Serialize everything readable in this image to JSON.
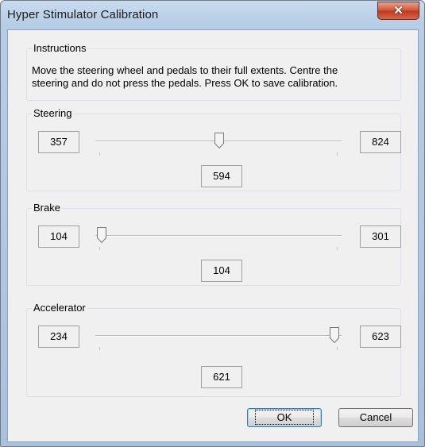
{
  "window": {
    "title": "Hyper Stimulator Calibration",
    "close_glyph": "✕"
  },
  "instructions": {
    "legend": "Instructions",
    "line1": "Move the steering wheel and pedals to their full extents. Centre the",
    "line2": "steering and do not press the pedals. Press OK to save calibration."
  },
  "steering": {
    "legend": "Steering",
    "min": "357",
    "max": "824",
    "current": "594",
    "position": 0.503
  },
  "brake": {
    "legend": "Brake",
    "min": "104",
    "max": "301",
    "current": "104",
    "position": 0.0
  },
  "accelerator": {
    "legend": "Accelerator",
    "min": "234",
    "max": "623",
    "current": "621",
    "position": 0.995
  },
  "buttons": {
    "ok": "OK",
    "cancel": "Cancel"
  }
}
